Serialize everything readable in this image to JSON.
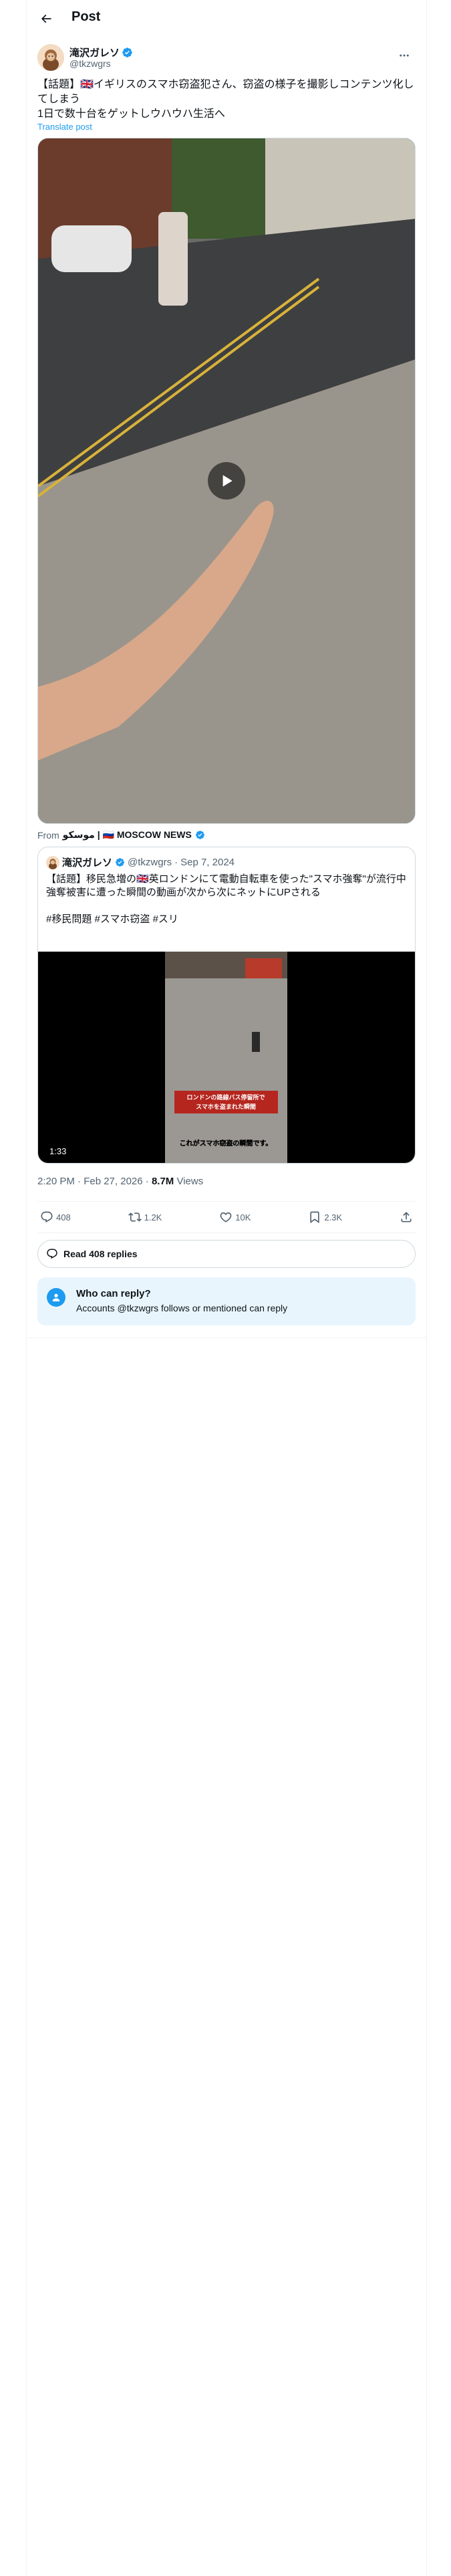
{
  "header": {
    "title": "Post",
    "back_icon": "arrow-left-icon"
  },
  "author": {
    "display_name": "滝沢ガレソ",
    "handle": "@tkzwgrs",
    "verified": true,
    "avatar_icon": "avatar-icon"
  },
  "post": {
    "text_line1": "【話題】🇬🇧イギリスのスマホ窃盗犯さん、窃盗の様子を撮影しコンテンツ化してしまう",
    "text_line2": "1日で数十台をゲットしウハウハ生活へ",
    "translate_label": "Translate post"
  },
  "video_source": {
    "prefix": "From",
    "name": "موسكو | 🇷🇺 MOSCOW NEWS"
  },
  "quote": {
    "display_name": "滝沢ガレソ",
    "handle": "@tkzwgrs",
    "separator": "·",
    "date": "Sep 7, 2024",
    "line1": "【話題】移民急増の🇬🇧英ロンドンにて電動自転車を使った\"スマホ強奪\"が流行中",
    "line2": "強奪被害に遭った瞬間の動画が次から次にネットにUPされる",
    "hashtags": "#移民問題 #スマホ窃盗 #スリ",
    "duration": "1:33",
    "caption_top": "ロンドンの路線バス停留所でスマホを盗まれた瞬間",
    "caption_bottom": "これがスマホ窃盗の瞬間です。"
  },
  "meta": {
    "time": "2:20 PM · Feb 27, 2026 · ",
    "views_count": "8.7M",
    "views_label": " Views"
  },
  "actions": {
    "replies": "408",
    "reposts": "1.2K",
    "likes": "10K",
    "bookmarks": "2.3K"
  },
  "read_replies_label": "Read 408 replies",
  "who_can_reply": {
    "title": "Who can reply?",
    "subtitle": "Accounts @tkzwgrs follows or mentioned can reply"
  },
  "colors": {
    "accent": "#1d9bf0",
    "text_primary": "#0f1419",
    "text_secondary": "#536471",
    "border": "#cfd9de"
  }
}
